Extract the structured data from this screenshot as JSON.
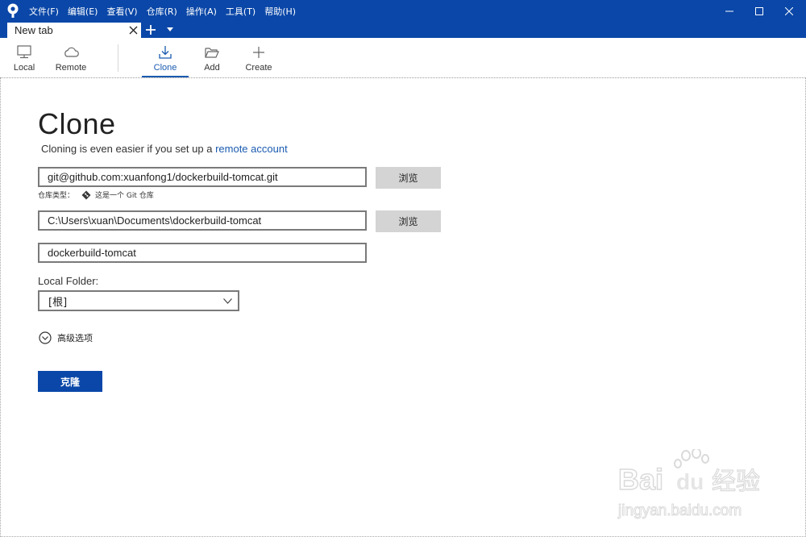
{
  "titlebar": {
    "menu": [
      "文件(F)",
      "编辑(E)",
      "查看(V)",
      "仓库(R)",
      "操作(A)",
      "工具(T)",
      "帮助(H)"
    ],
    "controls": [
      "minimize-icon",
      "maximize-icon",
      "close-icon"
    ]
  },
  "tabs": {
    "items": [
      {
        "label": "New tab",
        "active": true
      }
    ]
  },
  "toolbar": {
    "local_label": "Local",
    "remote_label": "Remote",
    "clone_label": "Clone",
    "add_label": "Add",
    "create_label": "Create",
    "active": "Clone"
  },
  "clone_page": {
    "title": "Clone",
    "subtitle_text": "Cloning is even easier if you set up a ",
    "subtitle_link": "remote account",
    "source_url": "git@github.com:xuanfong1/dockerbuild-tomcat.git",
    "browse_label": "浏览",
    "repo_type_label": "仓库类型：",
    "repo_type_value": "这是一个 Git 仓库",
    "destination_path": "C:\\Users\\xuan\\Documents\\dockerbuild-tomcat",
    "browse_label_2": "浏览",
    "name": "dockerbuild-tomcat",
    "local_folder_label": "Local Folder:",
    "local_folder_value": "[根]",
    "advanced_label": "高级选项",
    "clone_button": "克隆"
  },
  "watermark": {
    "brand": "Bai",
    "brand2": "du",
    "brand_cn": "经验",
    "url": "jingyan.baidu.com"
  },
  "colors": {
    "titlebar": "#0a47a8",
    "accent": "#1a5bb0",
    "button_gray": "#d4d4d4"
  }
}
